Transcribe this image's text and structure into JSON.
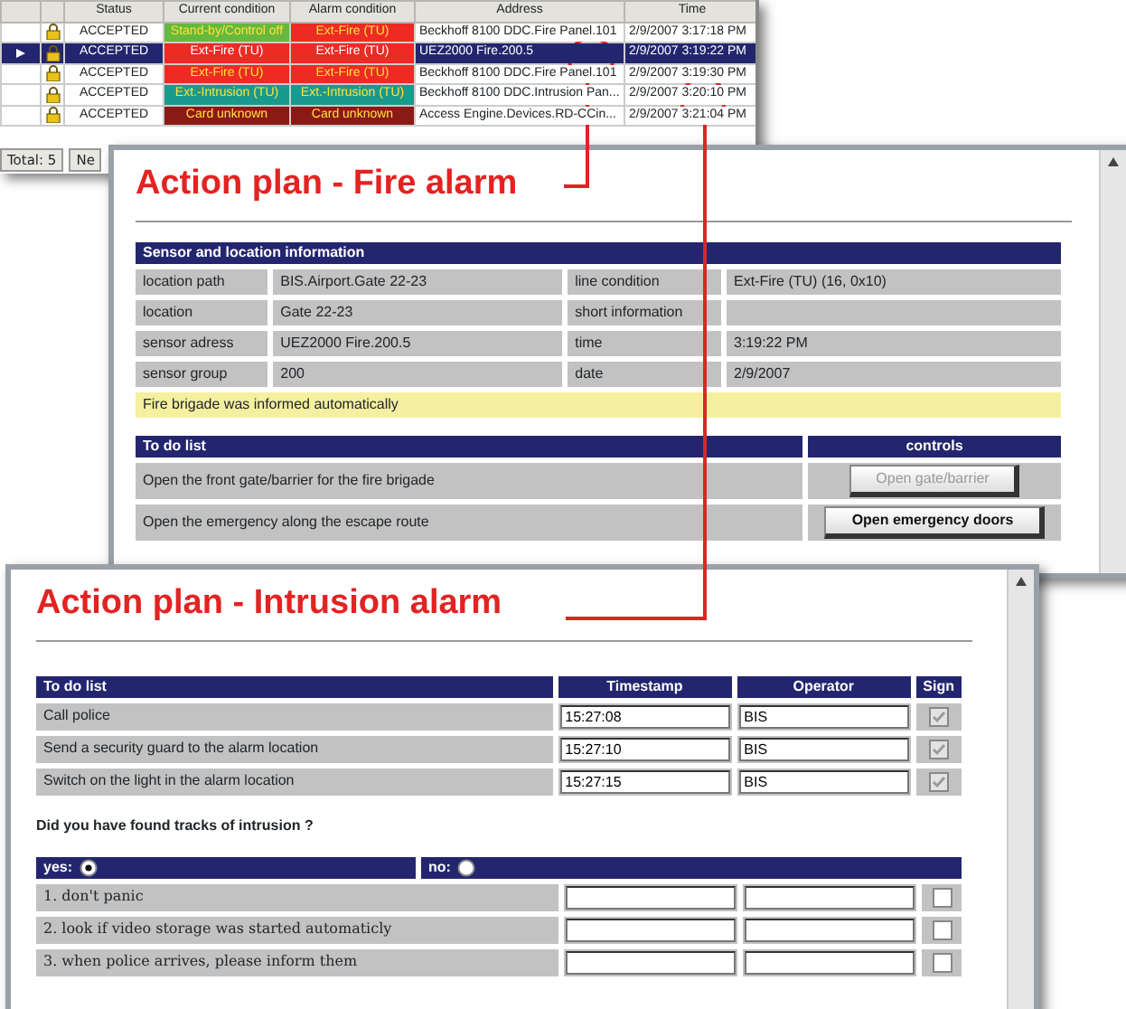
{
  "event_list": {
    "columns": [
      "Status",
      "Current condition",
      "Alarm condition",
      "Address",
      "Time"
    ],
    "rows": [
      {
        "selected": false,
        "status": "ACCEPTED",
        "current_condition": {
          "text": "Stand-by/Control off",
          "color": "#66b83e"
        },
        "alarm_condition": {
          "text": "Ext-Fire (TU)",
          "color": "#ee2a24"
        },
        "address": "Beckhoff 8100 DDC.Fire Panel.101",
        "time": "2/9/2007 3:17:18 PM"
      },
      {
        "selected": true,
        "status": "ACCEPTED",
        "current_condition": {
          "text": "Ext-Fire (TU)",
          "color": "#ee2a24"
        },
        "alarm_condition": {
          "text": "Ext-Fire (TU)",
          "color": "#ee2a24"
        },
        "address": "UEZ2000 Fire.200.5",
        "time": "2/9/2007 3:19:22 PM"
      },
      {
        "selected": false,
        "status": "ACCEPTED",
        "current_condition": {
          "text": "Ext-Fire (TU)",
          "color": "#ee2a24"
        },
        "alarm_condition": {
          "text": "Ext-Fire (TU)",
          "color": "#ee2a24"
        },
        "address": "Beckhoff 8100 DDC.Fire Panel.101",
        "time": "2/9/2007 3:19:30 PM"
      },
      {
        "selected": false,
        "status": "ACCEPTED",
        "current_condition": {
          "text": "Ext.-Intrusion (TU)",
          "color": "#1a9a8c"
        },
        "alarm_condition": {
          "text": "Ext.-Intrusion (TU)",
          "color": "#1a9a8c"
        },
        "address": "Beckhoff 8100 DDC.Intrusion Pan...",
        "time": "2/9/2007 3:20:10 PM"
      },
      {
        "selected": false,
        "status": "ACCEPTED",
        "current_condition": {
          "text": "Card unknown",
          "color": "#8a1a16"
        },
        "alarm_condition": {
          "text": "Card unknown",
          "color": "#8a1a16"
        },
        "address": "Access Engine.Devices.RD-CCin...",
        "time": "2/9/2007 3:21:04 PM"
      }
    ],
    "status_bar": [
      "Total: 5",
      "Ne"
    ]
  },
  "fire_plan": {
    "title": "Action plan - Fire alarm",
    "info_header": "Sensor and location information",
    "info": [
      {
        "label": "location path",
        "value": "BIS.Airport.Gate 22-23",
        "label2": "line condition",
        "value2": "Ext-Fire (TU) (16, 0x10)"
      },
      {
        "label": "location",
        "value": "Gate 22-23",
        "label2": "short information"
      },
      {
        "label": "sensor adress",
        "value": "UEZ2000 Fire.200.5",
        "label2": "time",
        "value2": "3:19:22 PM"
      },
      {
        "label": "sensor group",
        "value": "200",
        "label2": "date",
        "value2": "2/9/2007"
      }
    ],
    "note": "Fire brigade was informed automatically",
    "todo_header": "To do list",
    "controls_header": "controls",
    "todo": [
      {
        "text": "Open the front gate/barrier for the fire brigade",
        "button": "Open gate/barrier",
        "disabled": true
      },
      {
        "text": "Open the emergency along the escape route",
        "button": "Open emergency doors",
        "disabled": false
      }
    ]
  },
  "intrusion_plan": {
    "title": "Action plan - Intrusion alarm",
    "columns": [
      "To do list",
      "Timestamp",
      "Operator",
      "Sign"
    ],
    "todo": [
      {
        "text": "Call police",
        "timestamp": "15:27:08",
        "operator": "BIS",
        "checked": true
      },
      {
        "text": "Send a security guard to the alarm location",
        "timestamp": "15:27:10",
        "operator": "BIS",
        "checked": true
      },
      {
        "text": "Switch on the light in the alarm location",
        "timestamp": "15:27:15",
        "operator": "BIS",
        "checked": true
      }
    ],
    "question": "Did you have found tracks of intrusion ?",
    "options": [
      {
        "label": "yes:",
        "selected": true
      },
      {
        "label": "no:",
        "selected": false
      }
    ],
    "steps": [
      {
        "text": "1. don't panic",
        "checked": false
      },
      {
        "text": "2. look if video storage was started automaticly",
        "checked": false
      },
      {
        "text": "3. when police arrives, please inform them",
        "checked": false
      }
    ]
  }
}
